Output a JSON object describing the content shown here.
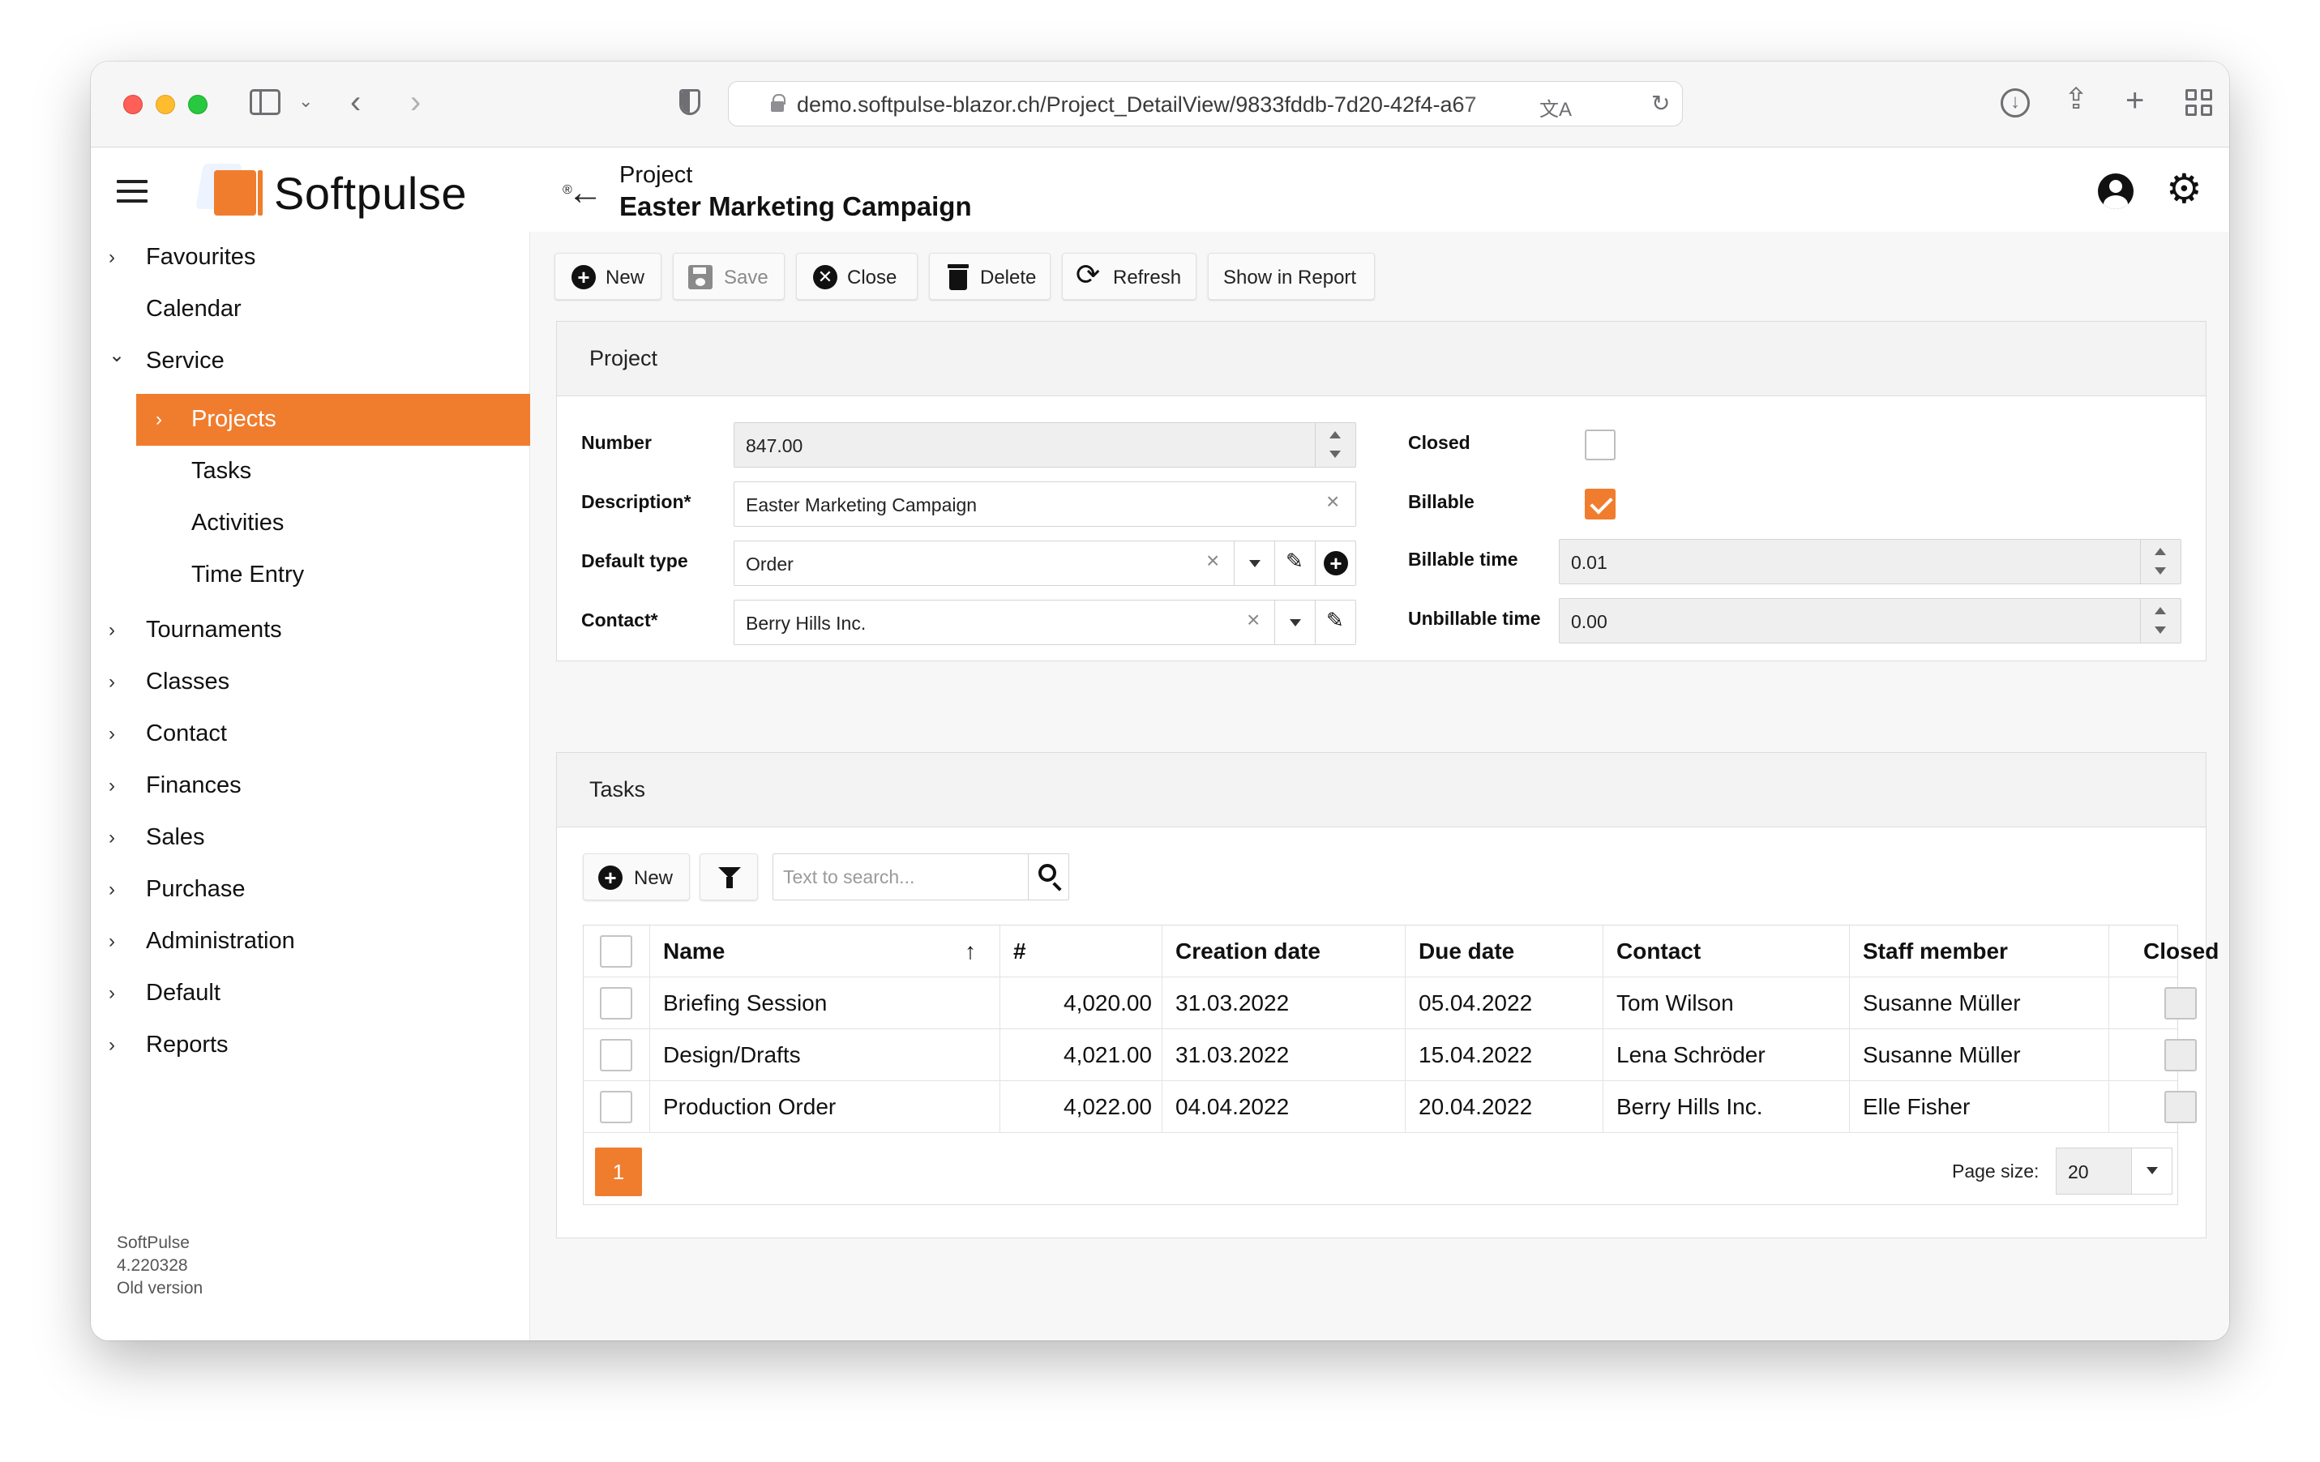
{
  "browser": {
    "url": "demo.softpulse-blazor.ch/Project_DetailView/9833fddb-7d20-42f4-a67"
  },
  "header": {
    "brand": "Softpulse",
    "brand_mark": "®",
    "subtitle": "Project",
    "title": "Easter Marketing Campaign"
  },
  "sidebar": {
    "items": [
      {
        "label": "Favourites",
        "chevron": "›"
      },
      {
        "label": "Calendar",
        "chevron": ""
      },
      {
        "label": "Service",
        "chevron": "⌄"
      },
      {
        "label": "Projects",
        "chevron": "›"
      },
      {
        "label": "Tasks",
        "chevron": ""
      },
      {
        "label": "Activities",
        "chevron": ""
      },
      {
        "label": "Time Entry",
        "chevron": ""
      },
      {
        "label": "Tournaments",
        "chevron": "›"
      },
      {
        "label": "Classes",
        "chevron": "›"
      },
      {
        "label": "Contact",
        "chevron": "›"
      },
      {
        "label": "Finances",
        "chevron": "›"
      },
      {
        "label": "Sales",
        "chevron": "›"
      },
      {
        "label": "Purchase",
        "chevron": "›"
      },
      {
        "label": "Administration",
        "chevron": "›"
      },
      {
        "label": "Default",
        "chevron": "›"
      },
      {
        "label": "Reports",
        "chevron": "›"
      }
    ],
    "version": {
      "name": "SoftPulse",
      "number": "4.220328",
      "link": "Old version"
    }
  },
  "toolbar": {
    "new": "New",
    "save": "Save",
    "close": "Close",
    "delete": "Delete",
    "refresh": "Refresh",
    "report": "Show in Report"
  },
  "project": {
    "title": "Project",
    "number_label": "Number",
    "number_value": "847.00",
    "description_label": "Description*",
    "description_value": "Easter Marketing Campaign",
    "default_type_label": "Default type",
    "default_type_value": "Order",
    "contact_label": "Contact*",
    "contact_value": "Berry Hills Inc.",
    "closed_label": "Closed",
    "closed_checked": false,
    "billable_label": "Billable",
    "billable_checked": true,
    "billable_time_label": "Billable time",
    "billable_time_value": "0.01",
    "unbillable_time_label": "Unbillable time",
    "unbillable_time_value": "0.00"
  },
  "tasks": {
    "title": "Tasks",
    "new": "New",
    "search_placeholder": "Text to search...",
    "columns": {
      "name": "Name",
      "sort_arrow": "↑",
      "number": "#",
      "creation_date": "Creation date",
      "due_date": "Due date",
      "contact": "Contact",
      "staff_member": "Staff member",
      "closed": "Closed"
    },
    "rows": [
      {
        "name": "Briefing Session",
        "number": "4,020.00",
        "creation_date": "31.03.2022",
        "due_date": "05.04.2022",
        "contact": "Tom Wilson",
        "staff_member": "Susanne Müller",
        "closed": false
      },
      {
        "name": "Design/Drafts",
        "number": "4,021.00",
        "creation_date": "31.03.2022",
        "due_date": "15.04.2022",
        "contact": "Lena Schröder",
        "staff_member": "Susanne Müller",
        "closed": false
      },
      {
        "name": "Production Order",
        "number": "4,022.00",
        "creation_date": "04.04.2022",
        "due_date": "20.04.2022",
        "contact": "Berry Hills Inc.",
        "staff_member": "Elle Fisher",
        "closed": false
      }
    ],
    "page": "1",
    "page_size_label": "Page size:",
    "page_size_value": "20"
  },
  "colors": {
    "accent": "#f07d2e"
  }
}
